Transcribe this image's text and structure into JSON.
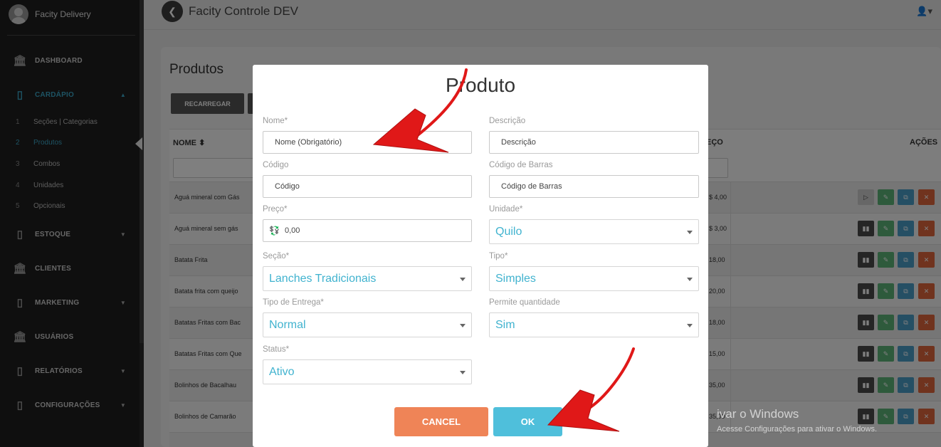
{
  "sidebar": {
    "brand": "Facity Delivery",
    "items": [
      {
        "label": "DASHBOARD",
        "icon": "bank-icon"
      },
      {
        "label": "CARDÁPIO",
        "icon": "book-icon",
        "active": true
      },
      {
        "label": "ESTOQUE",
        "icon": "book-icon"
      },
      {
        "label": "CLIENTES",
        "icon": "bank-icon"
      },
      {
        "label": "MARKETING",
        "icon": "book-icon"
      },
      {
        "label": "USUÁRIOS",
        "icon": "bank-icon"
      },
      {
        "label": "RELATÓRIOS",
        "icon": "book-icon"
      },
      {
        "label": "CONFIGURAÇÕES",
        "icon": "book-icon"
      }
    ],
    "sub_items": [
      {
        "num": "1",
        "label": "Seções | Categorias"
      },
      {
        "num": "2",
        "label": "Produtos",
        "active": true
      },
      {
        "num": "3",
        "label": "Combos"
      },
      {
        "num": "4",
        "label": "Unidades"
      },
      {
        "num": "5",
        "label": "Opcionais"
      }
    ]
  },
  "header": {
    "title": "Facity Controle DEV"
  },
  "page": {
    "title": "Produtos",
    "reload_label": "RECARREGAR",
    "columns": {
      "name": "NOME",
      "price": "EÇO",
      "actions": "AÇÕES"
    },
    "rows": [
      {
        "name": "Aguá mineral com Gás",
        "price": "$ 4,00"
      },
      {
        "name": "Aguá mineral sem gás",
        "price": "$ 3,00"
      },
      {
        "name": "Batata Frita",
        "price": "18,00"
      },
      {
        "name": "Batata frita com queijo",
        "price": "20,00"
      },
      {
        "name": "Batatas Fritas com Bac",
        "price": "18,00"
      },
      {
        "name": "Batatas Fritas com Que",
        "price": "15,00"
      },
      {
        "name": "Bolinhos de Bacalhau",
        "price": "35,00"
      },
      {
        "name": "Bolinhos de Camarão",
        "price": "35,00"
      }
    ],
    "watermark_title": "ivar o Windows",
    "watermark_text": "Acesse Configurações para ativar o Windows."
  },
  "modal": {
    "title": "Produto",
    "fields": {
      "nome": {
        "label": "Nome*",
        "placeholder": "Nome (Obrigatório)"
      },
      "descricao": {
        "label": "Descrição",
        "placeholder": "Descrição"
      },
      "codigo": {
        "label": "Código",
        "placeholder": "Código"
      },
      "codigo_barras": {
        "label": "Código de Barras",
        "placeholder": "Código de Barras"
      },
      "preco": {
        "label": "Preço*",
        "value": "0,00"
      },
      "unidade": {
        "label": "Unidade*",
        "value": "Quilo"
      },
      "secao": {
        "label": "Seção*",
        "value": "Lanches Tradicionais"
      },
      "tipo": {
        "label": "Tipo*",
        "value": "Simples"
      },
      "tipo_entrega": {
        "label": "Tipo de Entrega*",
        "value": "Normal"
      },
      "permite_quantidade": {
        "label": "Permite quantidade",
        "value": "Sim"
      },
      "status": {
        "label": "Status*",
        "value": "Ativo"
      }
    },
    "cancel_label": "CANCEL",
    "ok_label": "OK"
  },
  "colors": {
    "accent": "#3aa6c7",
    "cancel": "#ef8457",
    "ok": "#4fbfdb",
    "annotation_arrow": "#e01818"
  }
}
